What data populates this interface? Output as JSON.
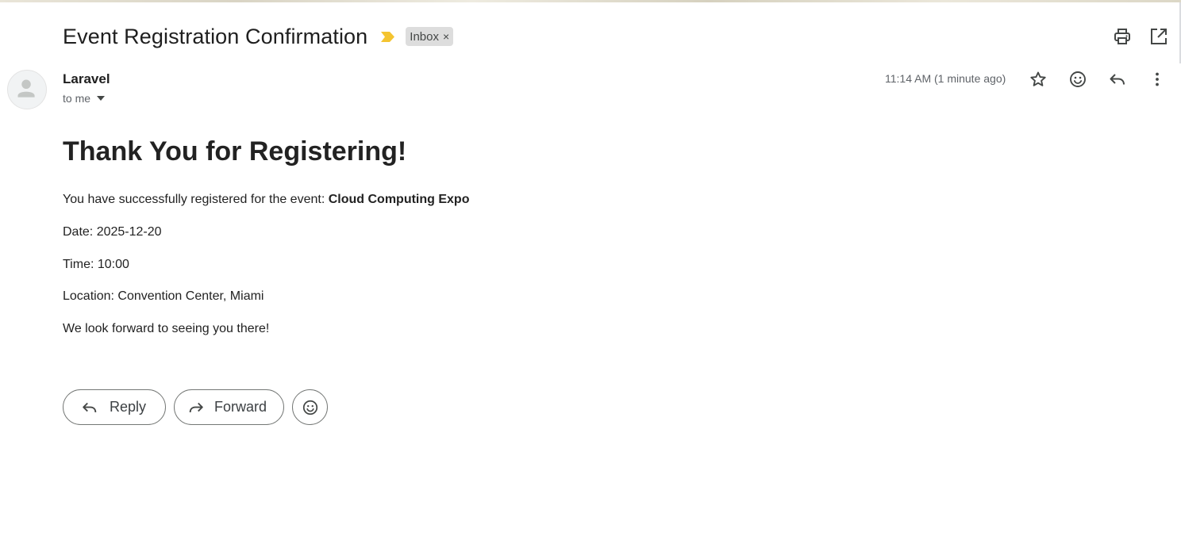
{
  "message": {
    "subject": "Event Registration Confirmation",
    "label": "Inbox",
    "label_remove": "×",
    "sender_name": "Laravel",
    "recipient": "to me",
    "timestamp": "11:14 AM (1 minute ago)"
  },
  "icons": {
    "importance": "importance-marker-icon",
    "print": "print-icon",
    "open_new_window": "open-in-new-window-icon",
    "star": "star-icon",
    "emoji": "emoji-reaction-icon",
    "reply": "reply-icon",
    "more": "more-vertical-icon",
    "forward": "forward-icon"
  },
  "colors": {
    "importance": "#f4c430",
    "label_bg": "#dddddd",
    "text_primary": "#1f1f1f",
    "text_secondary": "#5f6368"
  },
  "email_body": {
    "heading": "Thank You for Registering!",
    "event_intro": "You have successfully registered for the event: ",
    "event_name": "Cloud Computing Expo",
    "date": "Date: 2025-12-20",
    "time": "Time: 10:00",
    "location": "Location: Convention Center, Miami",
    "closing": "We look forward to seeing you there!"
  },
  "actions": {
    "reply_label": "Reply",
    "forward_label": "Forward"
  }
}
